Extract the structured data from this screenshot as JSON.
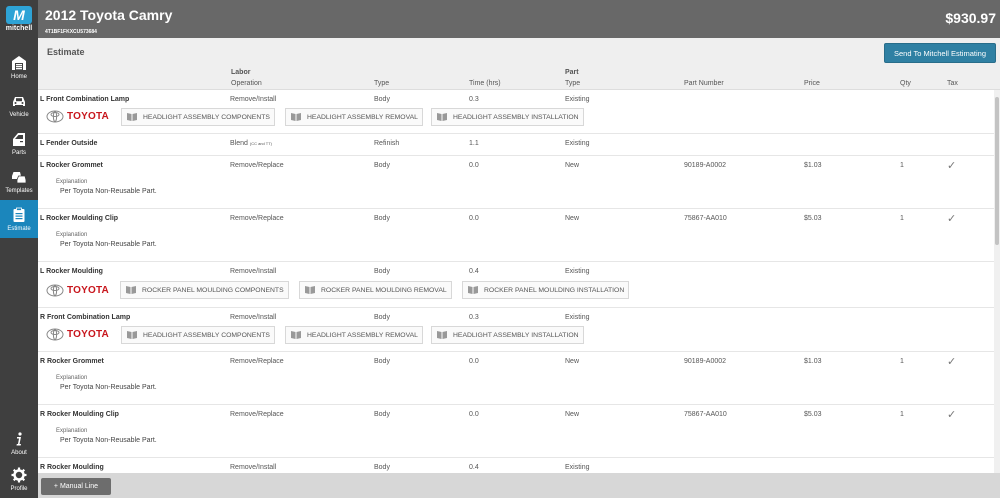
{
  "app": {
    "logo_text": "mitchell"
  },
  "nav": {
    "home": "Home",
    "vehicle": "Vehicle",
    "parts": "Parts",
    "templates": "Templates",
    "estimate": "Estimate",
    "about": "About",
    "profile": "Profile"
  },
  "header": {
    "title": "2012 Toyota Camry",
    "vin": "4T1BF1FKXCU573684",
    "total": "$930.97"
  },
  "estimate": {
    "title": "Estimate",
    "send_button": "Send To Mitchell Estimating"
  },
  "columns": {
    "labor_group": "Labor",
    "operation": "Operation",
    "type": "Type",
    "time": "Time (hrs)",
    "part_group": "Part",
    "part_type": "Type",
    "part_number": "Part Number",
    "price": "Price",
    "qty": "Qty",
    "tax": "Tax"
  },
  "brand": "TOYOTA",
  "explanation_label": "Explanation",
  "rows": [
    {
      "name": "L Front Combination Lamp",
      "operation": "Remove/Install",
      "type": "Body",
      "time": "0.3",
      "part_type": "Existing",
      "guides": [
        "HEADLIGHT ASSEMBLY COMPONENTS",
        "HEADLIGHT ASSEMBLY REMOVAL",
        "HEADLIGHT ASSEMBLY INSTALLATION"
      ]
    },
    {
      "name": "L Fender Outside",
      "operation": "Blend",
      "operation_note": "(CC and TT)",
      "type": "Refinish",
      "time": "1.1",
      "part_type": "Existing"
    },
    {
      "name": "L Rocker Grommet",
      "operation": "Remove/Replace",
      "type": "Body",
      "time": "0.0",
      "part_type": "New",
      "part_number": "90189-A0002",
      "price": "$1.03",
      "qty": "1",
      "tax": "✓",
      "explanation": "Per Toyota Non-Reusable Part."
    },
    {
      "name": "L Rocker Moulding Clip",
      "operation": "Remove/Replace",
      "type": "Body",
      "time": "0.0",
      "part_type": "New",
      "part_number": "75867-AA010",
      "price": "$5.03",
      "qty": "1",
      "tax": "✓",
      "explanation": "Per Toyota Non-Reusable Part."
    },
    {
      "name": "L Rocker Moulding",
      "operation": "Remove/Install",
      "type": "Body",
      "time": "0.4",
      "part_type": "Existing",
      "guides": [
        "ROCKER PANEL MOULDING COMPONENTS",
        "ROCKER PANEL MOULDING REMOVAL",
        "ROCKER PANEL MOULDING INSTALLATION"
      ]
    },
    {
      "name": "R Front Combination Lamp",
      "operation": "Remove/Install",
      "type": "Body",
      "time": "0.3",
      "part_type": "Existing",
      "guides": [
        "HEADLIGHT ASSEMBLY COMPONENTS",
        "HEADLIGHT ASSEMBLY REMOVAL",
        "HEADLIGHT ASSEMBLY INSTALLATION"
      ]
    },
    {
      "name": "R Rocker Grommet",
      "operation": "Remove/Replace",
      "type": "Body",
      "time": "0.0",
      "part_type": "New",
      "part_number": "90189-A0002",
      "price": "$1.03",
      "qty": "1",
      "tax": "✓",
      "explanation": "Per Toyota Non-Reusable Part."
    },
    {
      "name": "R Rocker Moulding Clip",
      "operation": "Remove/Replace",
      "type": "Body",
      "time": "0.0",
      "part_type": "New",
      "part_number": "75867-AA010",
      "price": "$5.03",
      "qty": "1",
      "tax": "✓",
      "explanation": "Per Toyota Non-Reusable Part."
    },
    {
      "name": "R Rocker Moulding",
      "operation": "Remove/Install",
      "type": "Body",
      "time": "0.4",
      "part_type": "Existing"
    }
  ],
  "footer": {
    "manual_line_button": "+ Manual Line"
  },
  "colors": {
    "sidebar": "#3f3f3f",
    "active_nav": "#1b86bc",
    "header": "#686868",
    "send_button": "#2f80a3",
    "brand_red": "#c8161d"
  }
}
